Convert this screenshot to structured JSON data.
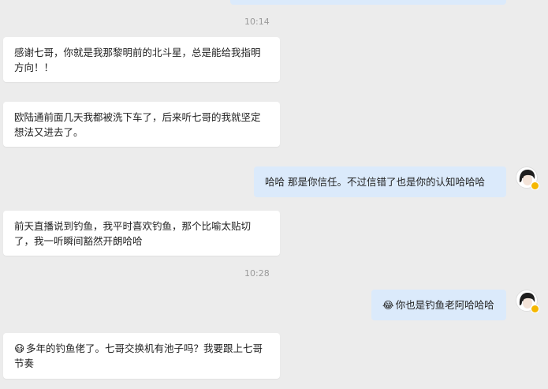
{
  "timestamps": [
    "10:14",
    "10:28"
  ],
  "messages": [
    {
      "side": "in",
      "text": "感谢七哥，你就是我那黎明前的北斗星，总是能给我指明\n方向！！"
    },
    {
      "side": "in",
      "text": "欧陆通前面几天我都被洗下车了，后来听七哥的我就坚定\n想法又进去了。"
    },
    {
      "side": "out",
      "text": "哈哈 那是你信任。不过信错了也是你的认知哈哈哈"
    },
    {
      "side": "in",
      "text": "前天直播说到钓鱼，我平时喜欢钓鱼，那个比喻太贴切\n了，我一听瞬间豁然开朗哈哈"
    },
    {
      "side": "out",
      "emoji": "😂",
      "text": "你也是钓鱼老阿哈哈哈"
    },
    {
      "side": "in",
      "emoji": "😷",
      "text": "多年的钓鱼佬了。七哥交换机有池子吗？我要跟上七哥\n节奏"
    }
  ],
  "colors": {
    "background": "#ececec",
    "incoming": "#ffffff",
    "outgoing": "#dbeafb",
    "badge": "#f5b700"
  },
  "icons": {
    "avatar": "user-avatar-icon",
    "badge": "verified-badge-icon"
  }
}
